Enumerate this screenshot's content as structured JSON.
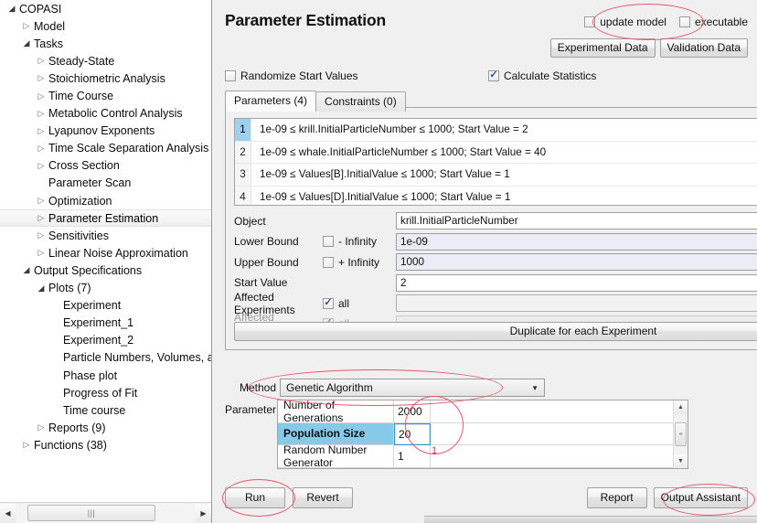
{
  "tree": {
    "items": [
      {
        "label": "COPASI",
        "indent": 0,
        "twisty": "open",
        "selected": false
      },
      {
        "label": "Model",
        "indent": 1,
        "twisty": "closed",
        "selected": false
      },
      {
        "label": "Tasks",
        "indent": 1,
        "twisty": "open",
        "selected": false
      },
      {
        "label": "Steady-State",
        "indent": 2,
        "twisty": "closed",
        "selected": false
      },
      {
        "label": "Stoichiometric Analysis",
        "indent": 2,
        "twisty": "closed",
        "selected": false
      },
      {
        "label": "Time Course",
        "indent": 2,
        "twisty": "closed",
        "selected": false
      },
      {
        "label": "Metabolic Control Analysis",
        "indent": 2,
        "twisty": "closed",
        "selected": false
      },
      {
        "label": "Lyapunov Exponents",
        "indent": 2,
        "twisty": "closed",
        "selected": false
      },
      {
        "label": "Time Scale Separation Analysis",
        "indent": 2,
        "twisty": "closed",
        "selected": false
      },
      {
        "label": "Cross Section",
        "indent": 2,
        "twisty": "closed",
        "selected": false
      },
      {
        "label": "Parameter Scan",
        "indent": 2,
        "twisty": "none",
        "selected": false
      },
      {
        "label": "Optimization",
        "indent": 2,
        "twisty": "closed",
        "selected": false
      },
      {
        "label": "Parameter Estimation",
        "indent": 2,
        "twisty": "closed",
        "selected": true
      },
      {
        "label": "Sensitivities",
        "indent": 2,
        "twisty": "closed",
        "selected": false
      },
      {
        "label": "Linear Noise Approximation",
        "indent": 2,
        "twisty": "closed",
        "selected": false
      },
      {
        "label": "Output Specifications",
        "indent": 1,
        "twisty": "open",
        "selected": false
      },
      {
        "label": "Plots (7)",
        "indent": 2,
        "twisty": "open",
        "selected": false
      },
      {
        "label": "Experiment",
        "indent": 3,
        "twisty": "none",
        "selected": false
      },
      {
        "label": "Experiment_1",
        "indent": 3,
        "twisty": "none",
        "selected": false
      },
      {
        "label": "Experiment_2",
        "indent": 3,
        "twisty": "none",
        "selected": false
      },
      {
        "label": "Particle Numbers, Volumes, and",
        "indent": 3,
        "twisty": "none",
        "selected": false
      },
      {
        "label": "Phase plot",
        "indent": 3,
        "twisty": "none",
        "selected": false
      },
      {
        "label": "Progress of Fit",
        "indent": 3,
        "twisty": "none",
        "selected": false
      },
      {
        "label": "Time course",
        "indent": 3,
        "twisty": "none",
        "selected": false
      },
      {
        "label": "Reports (9)",
        "indent": 2,
        "twisty": "closed",
        "selected": false
      },
      {
        "label": "Functions (38)",
        "indent": 1,
        "twisty": "closed",
        "selected": false
      }
    ],
    "scrollbar": {
      "left_arrow": "◀",
      "right_arrow": "▶",
      "grip": "|||"
    }
  },
  "header": {
    "title": "Parameter Estimation",
    "update_model_label": "update model",
    "update_model_checked": false,
    "executable_label": "executable",
    "executable_checked": false,
    "experimental_data_button": "Experimental Data",
    "validation_data_button": "Validation Data"
  },
  "options": {
    "randomize_label": "Randomize Start Values",
    "randomize_checked": false,
    "calculate_stats_label": "Calculate Statistics",
    "calculate_stats_checked": true,
    "check_tick": "✓"
  },
  "tabs": [
    {
      "label": "Parameters (4)",
      "active": true
    },
    {
      "label": "Constraints (0)",
      "active": false
    }
  ],
  "parameter_list": {
    "rows": [
      {
        "num": "1",
        "text": "1e-09 ≤ krill.InitialParticleNumber ≤ 1000; Start Value = 2",
        "selected": true
      },
      {
        "num": "2",
        "text": "1e-09 ≤ whale.InitialParticleNumber ≤ 1000; Start Value = 40",
        "selected": false
      },
      {
        "num": "3",
        "text": "1e-09 ≤ Values[B].InitialValue ≤ 1000; Start Value = 1",
        "selected": false
      },
      {
        "num": "4",
        "text": "1e-09 ≤ Values[D].InitialValue ≤ 1000; Start Value = 1",
        "selected": false
      }
    ],
    "scroll_up": "▲",
    "scroll_down": "▼"
  },
  "detail_form": {
    "object_label": "Object",
    "object_value": "krill.InitialParticleNumber",
    "lower_bound_label": "Lower Bound",
    "lower_infinity_label": "- Infinity",
    "lower_infinity_checked": false,
    "lower_bound_value": "1e-09",
    "upper_bound_label": "Upper Bound",
    "upper_infinity_label": "+ Infinity",
    "upper_infinity_checked": false,
    "upper_bound_value": "1000",
    "start_value_label": "Start Value",
    "start_value": "2",
    "affected_experiments_label": "Affected Experiments",
    "affected_experiments_all": "all",
    "affected_experiments_checked": true,
    "affected_experiments_value": "",
    "affected_validations_label": "Affected Validations",
    "affected_validations_all": "all",
    "affected_validations_checked": true,
    "affected_validations_value": "",
    "dots_label": "•••",
    "combo_caret": "▼",
    "duplicate_button": "Duplicate for each Experiment"
  },
  "side_tools": {
    "add_label": "+",
    "remove_label": "−",
    "move_up_label": "▲",
    "move_down_label": "▼",
    "clear_label": ""
  },
  "method": {
    "label": "Method",
    "value": "Genetic Algorithm",
    "caret": "▼"
  },
  "method_parameters": {
    "label": "Parameter",
    "rows": [
      {
        "name": "Number of Generations",
        "value": "2000",
        "selected": false
      },
      {
        "name": "Population Size",
        "value": "20",
        "selected": true
      },
      {
        "name": "Random Number Generator",
        "value": "1",
        "selected": false
      }
    ],
    "scroll_up": "▲",
    "scroll_down": "▼"
  },
  "footer": {
    "run_button": "Run",
    "revert_button": "Revert",
    "report_button": "Report",
    "output_assistant_button": "Output Assistant"
  },
  "annotations": {
    "color": "#e8596a",
    "marker_1": "1"
  }
}
